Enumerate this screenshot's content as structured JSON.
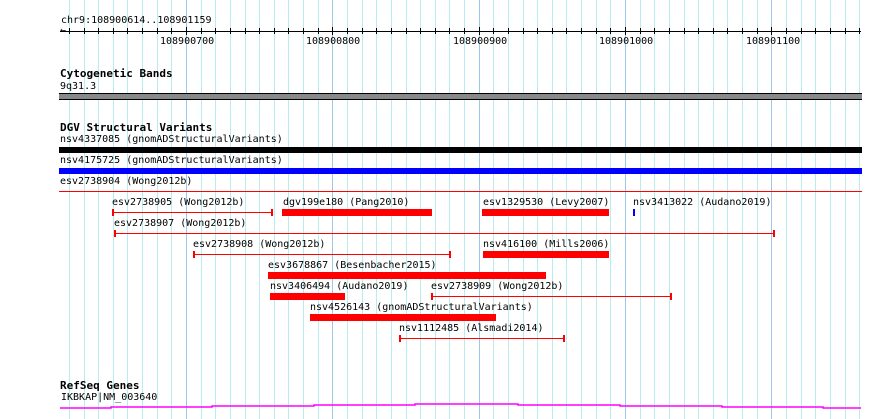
{
  "ruler": {
    "location": "chr9:108900614..108901159",
    "ticks": [
      "108900700",
      "108900800",
      "108900900",
      "108901000",
      "108901100"
    ]
  },
  "tracks": {
    "cytobands": {
      "title": "Cytogenetic Bands",
      "band": "9q31.3"
    },
    "dgv": {
      "title": "DGV Structural Variants",
      "features": [
        {
          "label": "nsv4337085 (gnomADStructuralVariants)"
        },
        {
          "label": "nsv4175725 (gnomADStructuralVariants)"
        },
        {
          "label": "esv2738904 (Wong2012b)"
        },
        {
          "label": "esv2738905 (Wong2012b)"
        },
        {
          "label": "dgv199e180 (Pang2010)"
        },
        {
          "label": "esv1329530 (Levy2007)"
        },
        {
          "label": "nsv3413022 (Audano2019)"
        },
        {
          "label": "esv2738907 (Wong2012b)"
        },
        {
          "label": "esv2738908 (Wong2012b)"
        },
        {
          "label": "nsv416100 (Mills2006)"
        },
        {
          "label": "esv3678867 (Besenbacher2015)"
        },
        {
          "label": "nsv3406494 (Audano2019)"
        },
        {
          "label": "esv2738909 (Wong2012b)"
        },
        {
          "label": "nsv4526143 (gnomADStructuralVariants)"
        },
        {
          "label": "nsv1112485 (Alsmadi2014)"
        }
      ]
    },
    "refseq": {
      "title": "RefSeq Genes",
      "gene": "IKBKAP|NM_003640"
    }
  },
  "colors": {
    "loss": "#ff0000",
    "gain": "#0000ff",
    "complex": "#000000",
    "gene": "#ff00ff",
    "band": "#888888"
  }
}
